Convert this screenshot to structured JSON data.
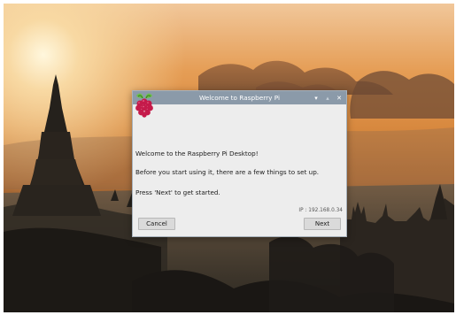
{
  "window": {
    "title": "Welcome to Raspberry Pi",
    "controls": [
      "minimize-icon",
      "maximize-icon",
      "close-icon"
    ]
  },
  "content": {
    "welcome": "Welcome to the Raspberry Pi Desktop!",
    "intro": "Before you start using it, there are a few things to set up.",
    "instruction": "Press 'Next' to get started.",
    "ip": "IP : 192.168.0.34"
  },
  "buttons": {
    "cancel": "Cancel",
    "next": "Next"
  },
  "colors": {
    "titlebar": "#8b9aa9",
    "dialog_bg": "#ededed",
    "button_bg": "#dadada",
    "raspberry_red": "#c51a4a",
    "leaf_green": "#6cc04a"
  },
  "icons": {
    "logo": "raspberry-pi-logo-icon"
  }
}
